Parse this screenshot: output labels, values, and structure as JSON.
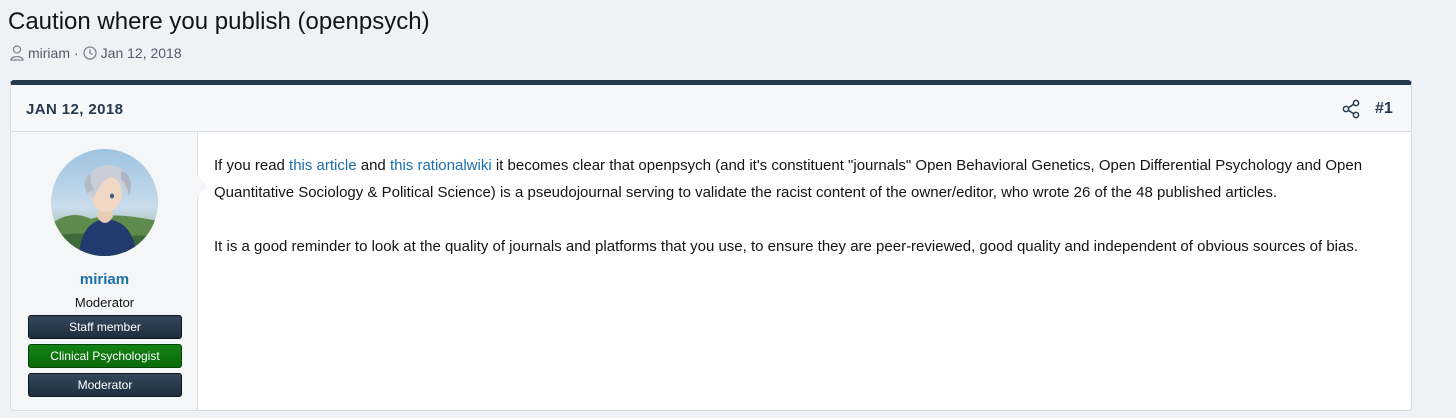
{
  "thread": {
    "title": "Caution where you publish (openpsych)",
    "author": "miriam",
    "separator": "·",
    "date": "Jan 12, 2018"
  },
  "post": {
    "date": "JAN 12, 2018",
    "number": "#1",
    "user": {
      "name": "miriam",
      "title": "Moderator",
      "banners": {
        "staff": "Staff member",
        "clinical": "Clinical Psychologist",
        "moderator": "Moderator"
      }
    },
    "body": {
      "p1_pre": "If you read ",
      "p1_link1": "this article",
      "p1_mid": " and ",
      "p1_link2": "this rationalwiki",
      "p1_post": " it becomes clear that openpsych (and it's constituent \"journals\" Open Behavioral Genetics, Open Differential Psychology and Open Quantitative Sociology & Political Science) is a pseudojournal serving to validate the racist content of the owner/editor, who wrote 26 of the 48 published articles.",
      "p2": "It is a good reminder to look at the quality of journals and platforms that you use, to ensure they are peer-reviewed, good quality and independent of obvious sources of bias."
    }
  },
  "colors": {
    "accent": "#25394f",
    "link": "#1c6fad",
    "clinical_banner": "#148214"
  },
  "icons": {
    "author": "user-icon",
    "date": "clock-icon",
    "share": "share-icon"
  }
}
